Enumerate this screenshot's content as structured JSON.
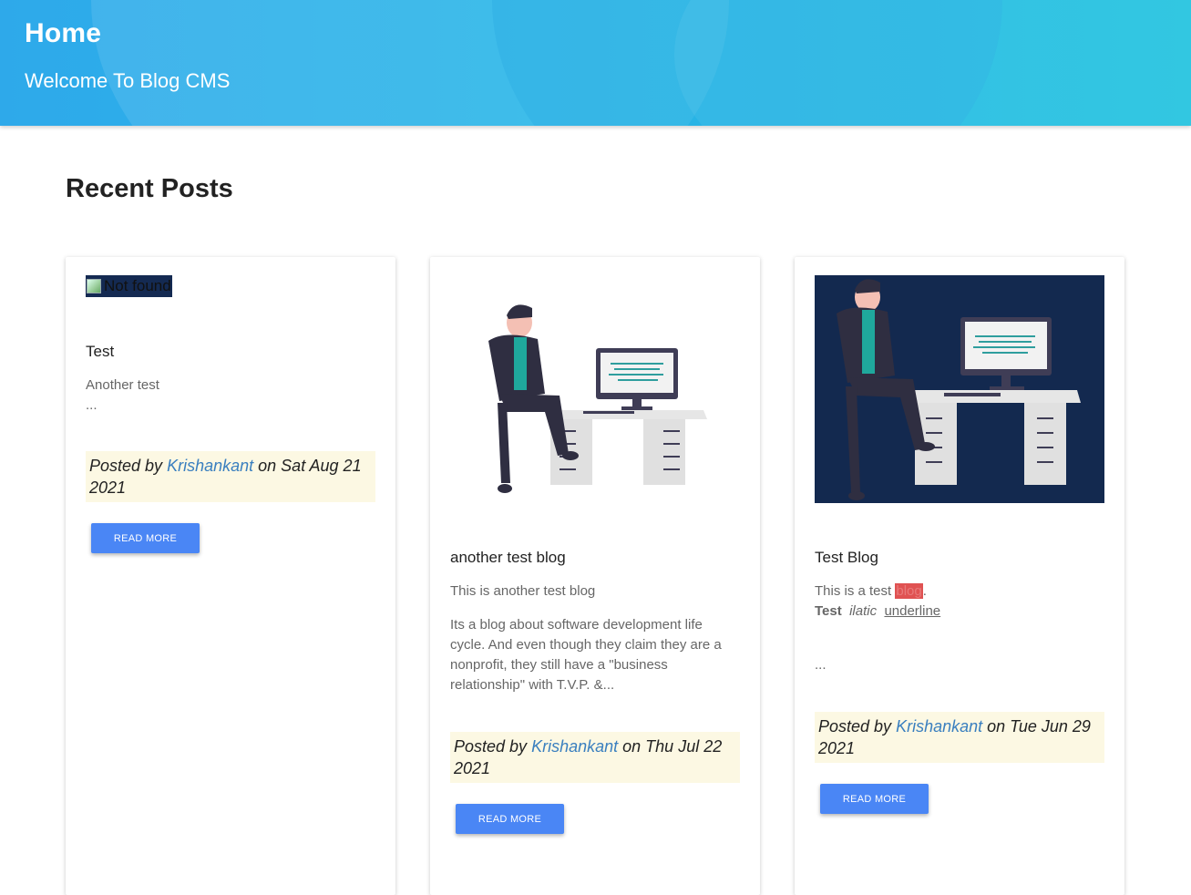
{
  "header": {
    "title": "Home",
    "subtitle": "Welcome To Blog CMS"
  },
  "section": {
    "title": "Recent Posts"
  },
  "colors": {
    "header_start": "#2ea9ea",
    "header_end": "#26c4e0",
    "button": "#4a86f5",
    "byline_bg": "#fcf8e3",
    "author_link": "#3a7fbf",
    "illustration_bg": "#13294f"
  },
  "posts": [
    {
      "image_alt": "Not found",
      "title": "Test",
      "excerpt": [
        "Another test",
        "..."
      ],
      "byline_prefix": "Posted by",
      "author": "Krishankant",
      "date": "on Sat Aug 21 2021",
      "button": "READ MORE"
    },
    {
      "title": "another test blog",
      "excerpt": [
        "This is another test blog",
        "Its a blog about software development life cycle.  And even though they claim they are a nonprofit, they still have a \"business relationship\" with T.V.P. &..."
      ],
      "byline_prefix": "Posted by",
      "author": "Krishankant",
      "date": "on Thu Jul 22 2021",
      "button": "READ MORE"
    },
    {
      "title": "Test Blog",
      "excerpt_line1_start": "This is a test ",
      "excerpt_highlight": "blog",
      "excerpt_line1_end": ".",
      "excerpt_bold": "Test",
      "excerpt_italic": "ilatic",
      "excerpt_underline": "underline",
      "excerpt_more": "...",
      "byline_prefix": "Posted by",
      "author": "Krishankant",
      "date": "on Tue Jun 29 2021",
      "button": "READ MORE"
    }
  ]
}
